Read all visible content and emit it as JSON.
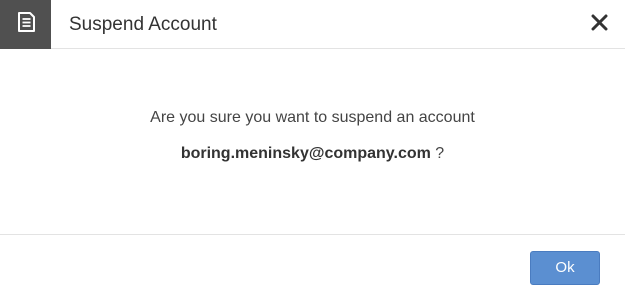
{
  "dialog": {
    "title": "Suspend Account",
    "header_icon": "document-icon",
    "close_icon": "close-icon"
  },
  "body": {
    "message": "Are you sure you want to suspend an account",
    "account_email": "boring.meninsky@company.com",
    "question_mark": " ?"
  },
  "footer": {
    "ok_label": "Ok"
  },
  "colors": {
    "header_icon_bg": "#505050",
    "ok_button": "#5b8fd1",
    "text": "#444444"
  }
}
